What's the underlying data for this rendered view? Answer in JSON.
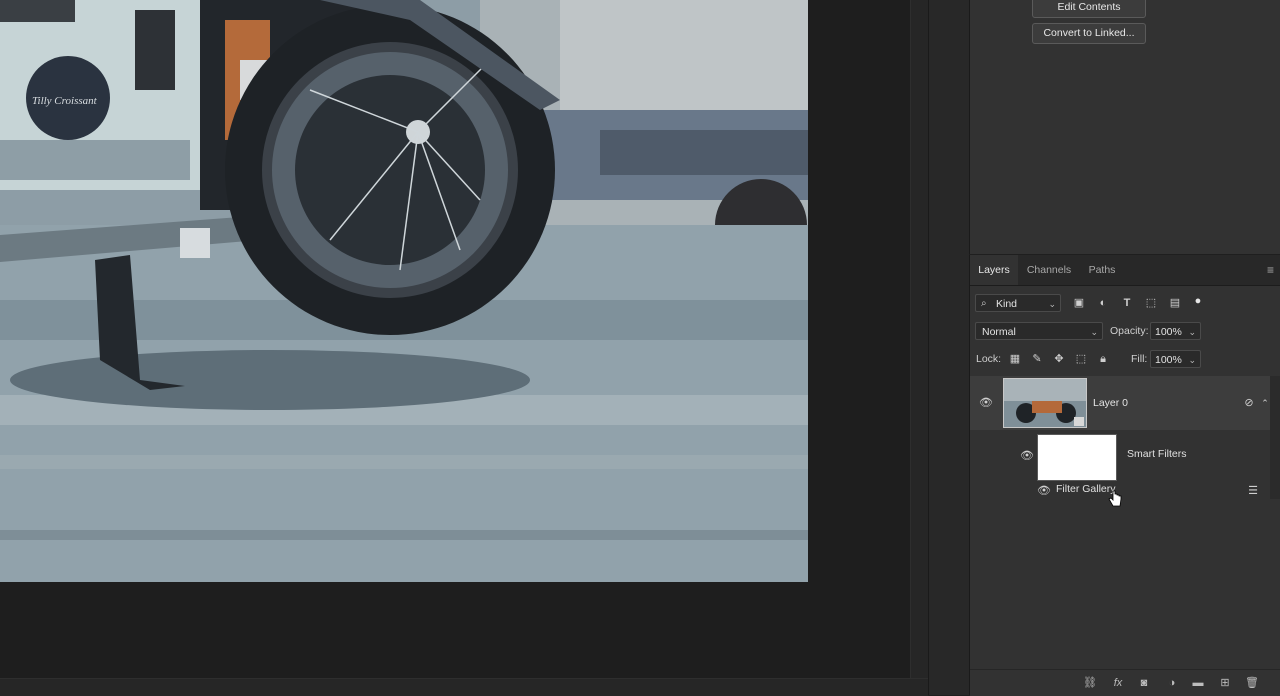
{
  "properties": {
    "edit_contents": "Edit Contents",
    "convert_linked": "Convert to Linked..."
  },
  "layers_panel": {
    "tabs": [
      "Layers",
      "Channels",
      "Paths"
    ],
    "filter_kind": "Kind",
    "blend_mode": "Normal",
    "opacity_label": "Opacity:",
    "opacity_value": "100%",
    "lock_label": "Lock:",
    "fill_label": "Fill:",
    "fill_value": "100%",
    "layers": [
      {
        "name": "Layer 0",
        "visible": true,
        "smart_object": true
      },
      {
        "name": "Smart Filters",
        "visible": true
      },
      {
        "name": "Filter Gallery",
        "visible": true
      }
    ]
  },
  "colors": {
    "panel_bg": "#323232",
    "selected_layer_bg": "#3d3d3d",
    "canvas_bg": "#1e1e1e"
  }
}
